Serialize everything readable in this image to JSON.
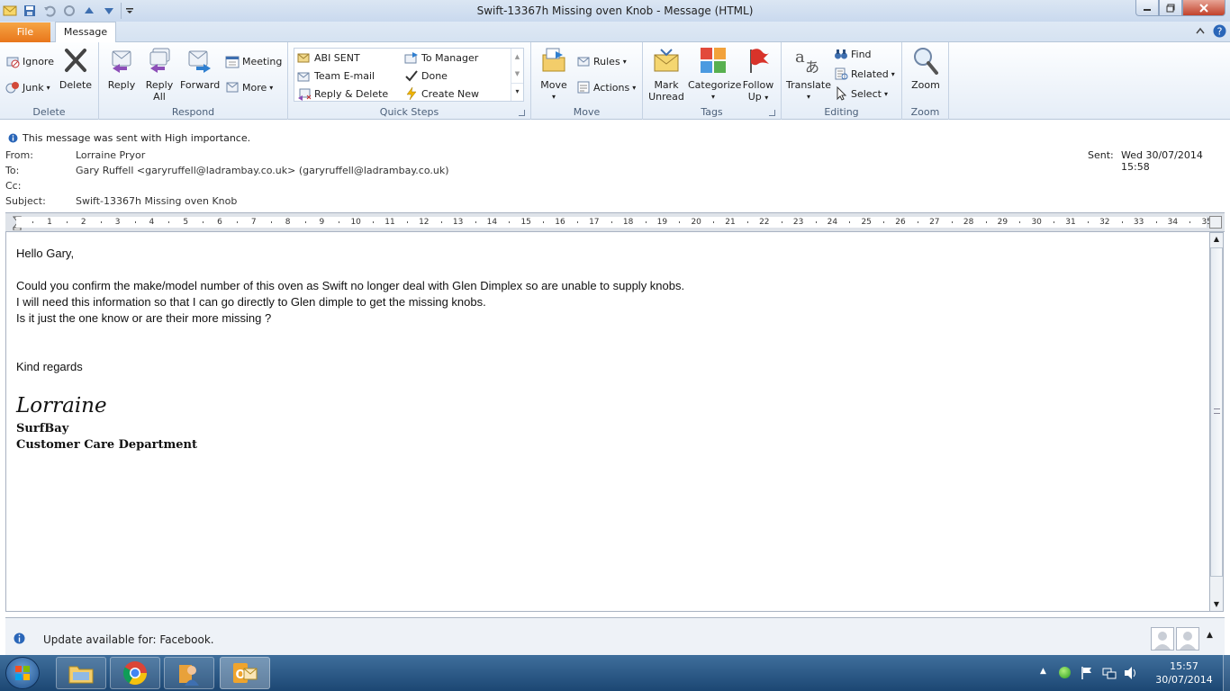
{
  "window": {
    "title": "Swift-13367h Missing oven Knob  -  Message (HTML)"
  },
  "tabs": {
    "file": "File",
    "message": "Message"
  },
  "ribbon": {
    "delete": {
      "label": "Delete",
      "ignore": "Ignore",
      "junk": "Junk",
      "delete": "Delete"
    },
    "respond": {
      "label": "Respond",
      "reply": "Reply",
      "reply_all_1": "Reply",
      "reply_all_2": "All",
      "forward": "Forward",
      "meeting": "Meeting",
      "more": "More"
    },
    "quick_steps": {
      "label": "Quick Steps",
      "items": [
        "ABI SENT",
        "Team E-mail",
        "Reply & Delete",
        "To Manager",
        "Done",
        "Create New"
      ]
    },
    "move": {
      "label": "Move",
      "move": "Move",
      "rules": "Rules",
      "actions": "Actions"
    },
    "tags": {
      "label": "Tags",
      "mark_unread_1": "Mark",
      "mark_unread_2": "Unread",
      "categorize": "Categorize",
      "follow_up_1": "Follow",
      "follow_up_2": "Up"
    },
    "editing": {
      "label": "Editing",
      "translate": "Translate",
      "find": "Find",
      "related": "Related",
      "select": "Select"
    },
    "zoom": {
      "label": "Zoom",
      "zoom": "Zoom"
    }
  },
  "message": {
    "importance_notice": "This message was sent with High importance.",
    "from_label": "From:",
    "from": "Lorraine Pryor",
    "to_label": "To:",
    "to": "Gary Ruffell <garyruffell@ladrambay.co.uk> (garyruffell@ladrambay.co.uk)",
    "cc_label": "Cc:",
    "subject_label": "Subject:",
    "subject": "Swift-13367h Missing oven Knob",
    "sent_label": "Sent:",
    "sent": "Wed 30/07/2014 15:58"
  },
  "ruler": {
    "marks": [
      "1",
      "2",
      "3",
      "4",
      "5",
      "6",
      "7",
      "8",
      "9",
      "10",
      "11",
      "12",
      "13",
      "14",
      "15",
      "16",
      "17",
      "18",
      "19",
      "20",
      "21",
      "22",
      "23",
      "24",
      "25",
      "26",
      "27",
      "28",
      "29",
      "30",
      "31",
      "32",
      "33",
      "34",
      "35"
    ]
  },
  "body": {
    "greeting": "Hello Gary,",
    "line1": "Could you confirm the make/model number of this oven as Swift no longer deal with Glen Dimplex so are unable to supply knobs.",
    "line2": "I will need this information so that I can go directly to Glen dimple to get the missing knobs.",
    "line3": "Is it just the one know or are their more missing ?",
    "closing": "Kind regards",
    "signature": "Lorraine",
    "company": "SurfBay",
    "department": "Customer Care Department"
  },
  "people_bar": {
    "update_text": "Update available for: Facebook."
  },
  "taskbar": {
    "time": "15:57",
    "date": "30/07/2014"
  },
  "colors": {
    "file_tab": "#e8761b",
    "ribbon_bg": "#e5edf7",
    "taskbar": "#1c4773"
  }
}
